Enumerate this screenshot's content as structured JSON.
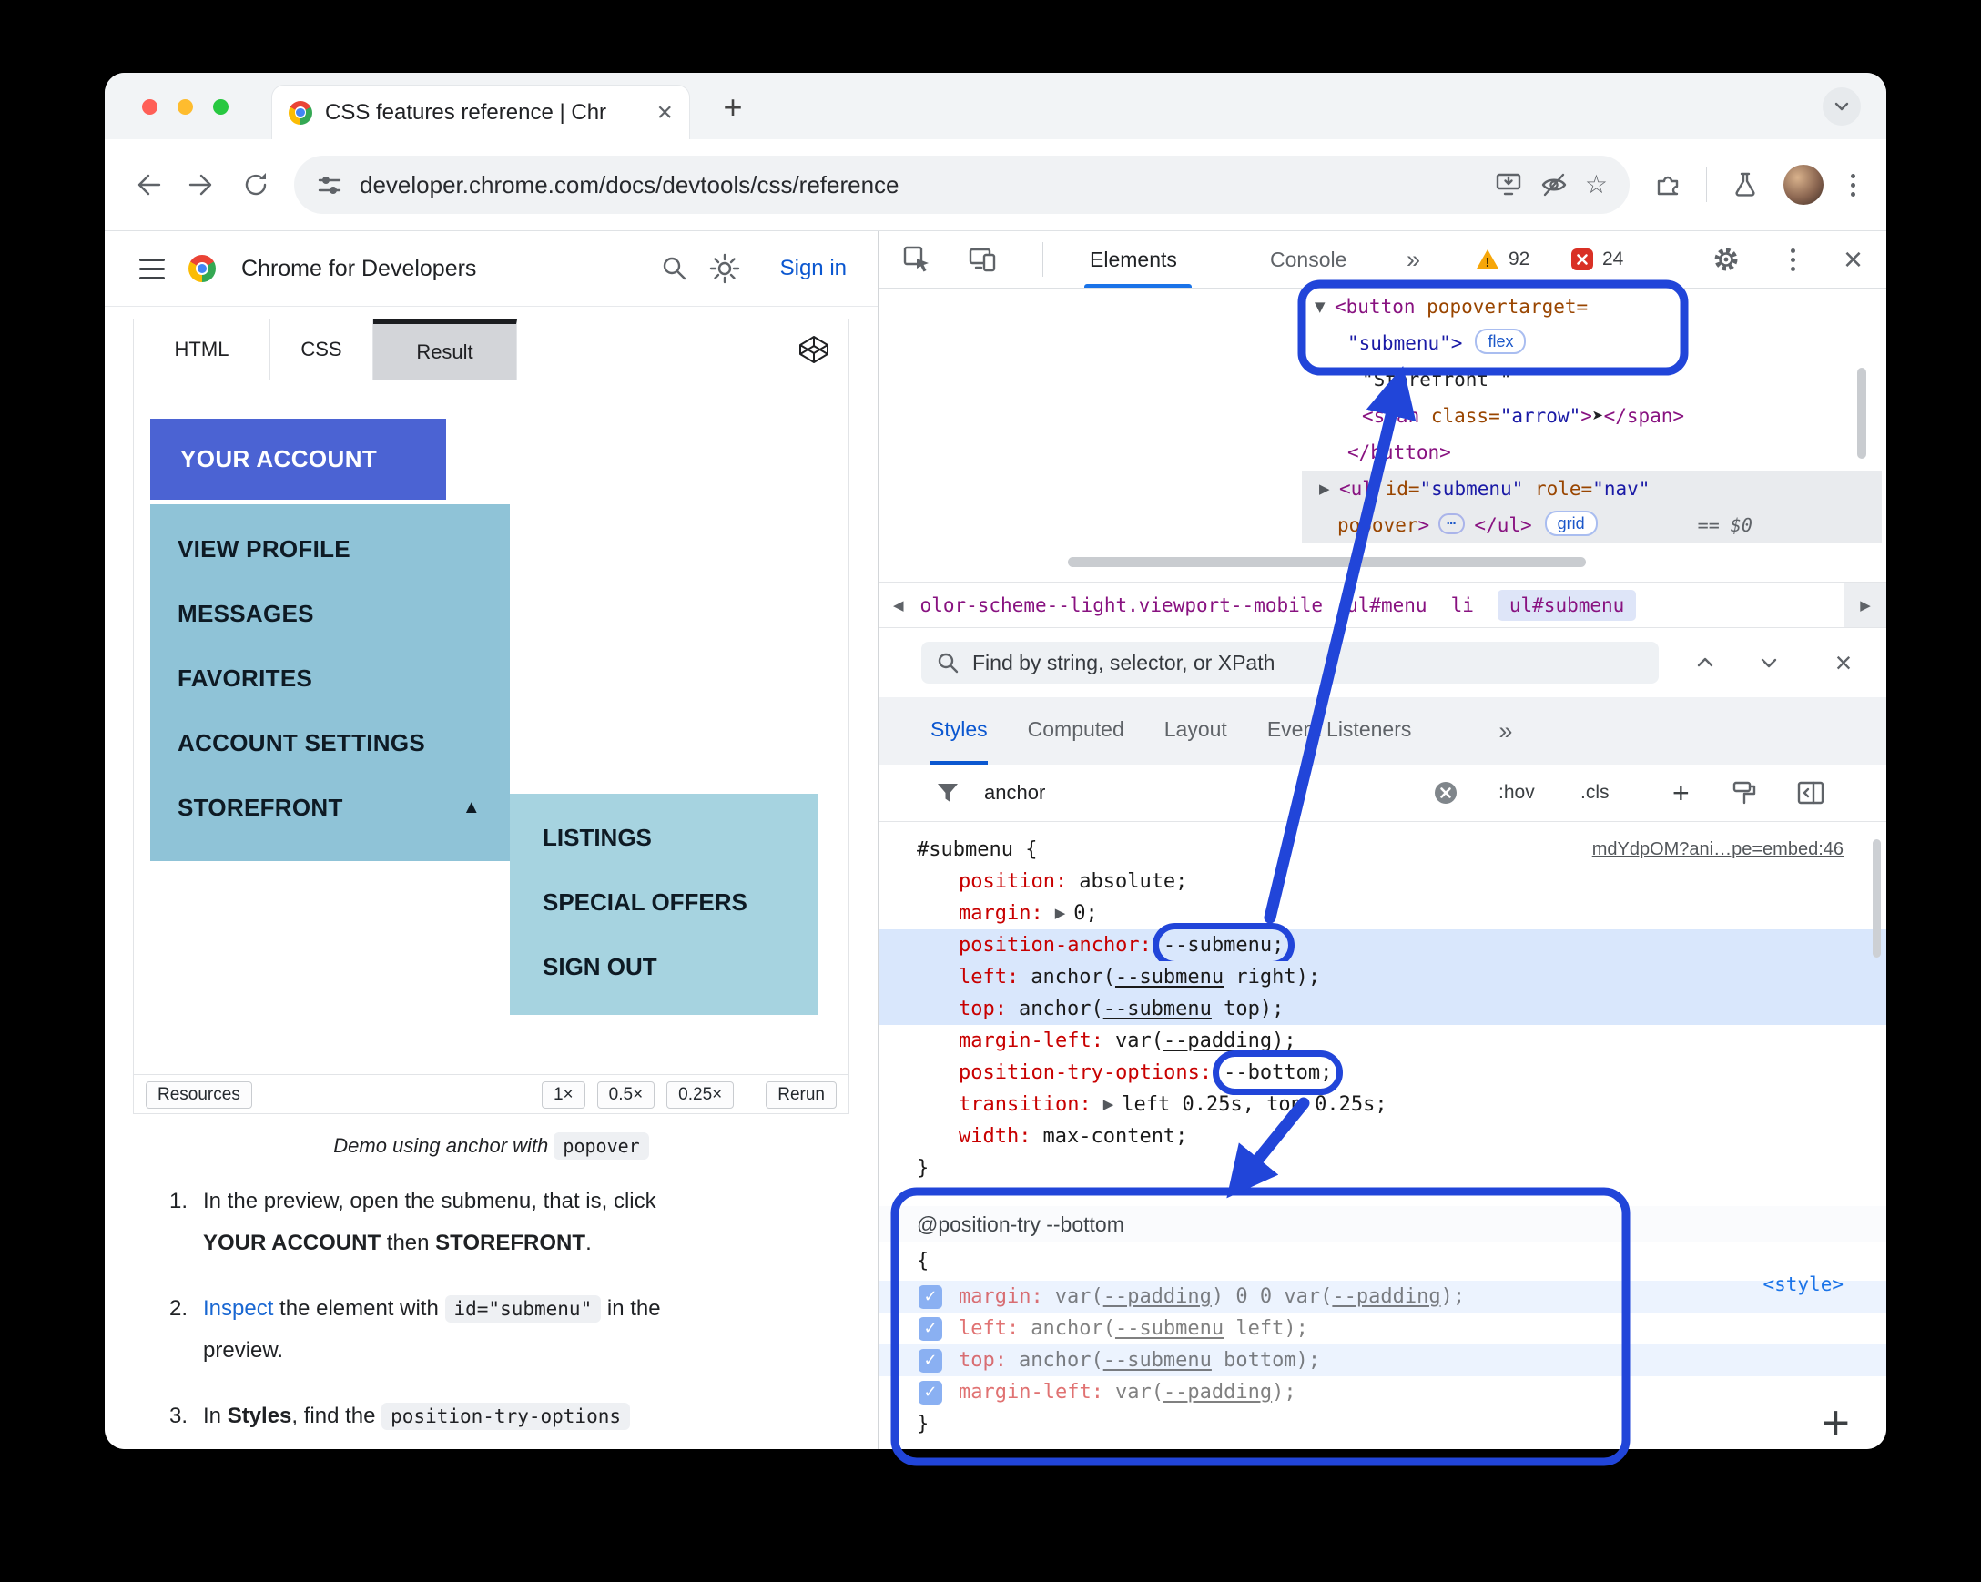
{
  "colors": {
    "annotation": "#2145d9",
    "accent_blue": "#1a73e8",
    "demo_button": "#4b63d3",
    "demo_menu": "#8fc3d7",
    "demo_submenu": "#a6d3e0",
    "warning": "#f6a609",
    "error": "#d93025"
  },
  "icons": {
    "close": "×",
    "plus": "+",
    "more": "»",
    "star": "☆",
    "tree_open": "▼",
    "tree_closed": "▶",
    "crumb_left": "◀",
    "crumb_right": "▶",
    "dots": "⋯",
    "check": "✓",
    "arrow_up": "▲"
  },
  "browser": {
    "tab_title": "CSS features reference  |  Chr",
    "url": "developer.chrome.com/docs/devtools/css/reference"
  },
  "docs": {
    "brand": "Chrome for Developers",
    "sign_in": "Sign in",
    "tabs": {
      "html": "HTML",
      "css": "CSS",
      "result": "Result"
    },
    "demo": {
      "account": "YOUR ACCOUNT",
      "items": [
        "VIEW PROFILE",
        "MESSAGES",
        "FAVORITES",
        "ACCOUNT SETTINGS"
      ],
      "storefront": "STOREFRONT",
      "sub_items": [
        "LISTINGS",
        "SPECIAL OFFERS",
        "SIGN OUT"
      ]
    },
    "footer": {
      "resources": "Resources",
      "s1": "1×",
      "s2": "0.5×",
      "s3": "0.25×",
      "rerun": "Rerun"
    },
    "caption": {
      "text": "Demo using anchor with ",
      "code": "popover"
    },
    "steps": {
      "n1": "1.",
      "s1a": "In the preview, open the submenu, that is, click",
      "s1b": "YOUR ACCOUNT",
      "s1c": " then ",
      "s1d": "STOREFRONT",
      "s1e": ".",
      "n2": "2.",
      "s2a": "Inspect",
      "s2b": " the element with ",
      "s2c": "id=\"submenu\"",
      "s2d": " in the",
      "s2e": "preview.",
      "n3": "3.",
      "s3a": "In ",
      "s3b": "Styles",
      "s3c": ", find the ",
      "s3d": "position-try-options"
    }
  },
  "devtools": {
    "tabs": {
      "elements": "Elements",
      "console": "Console"
    },
    "issues": {
      "warnings": "92",
      "errors": "24"
    },
    "tree": {
      "l1_tag": "<button",
      "l1_attr": " popovertarget=",
      "l2_val": "\"submenu\">",
      "l2_badge": "flex",
      "l3_text": "\"Storefront \"",
      "l4_o": "<span",
      "l4_attr": " class=",
      "l4_val": "\"arrow\"",
      "l4_b": ">",
      "l4_text": "➤",
      "l4_c": "</span>",
      "l5": "</button>",
      "l6_o": "<ul",
      "l6_a1": " id=",
      "l6_v1": "\"submenu\"",
      "l6_a2": " role=",
      "l6_v2": "\"nav\"",
      "l7_a": "popover",
      "l7_b": ">",
      "l7_c": "</ul>",
      "l7_badge": "grid",
      "l7_eq": "== $0"
    },
    "crumbs": {
      "c1": "olor-scheme--light.viewport--mobile",
      "c2": "ul#menu",
      "c3": "li",
      "c4": "ul#submenu"
    },
    "find": "Find by string, selector, or XPath",
    "panel_tabs": {
      "styles": "Styles",
      "computed": "Computed",
      "layout": "Layout",
      "events": "Event Listeners"
    },
    "filter": {
      "query": "anchor",
      "hov": ":hov",
      "cls": ".cls",
      "plus": "+"
    },
    "rule": {
      "selector": "#submenu {",
      "link": "mdYdpOM?ani…pe=embed:46",
      "p1n": "position:",
      "p1v": "absolute;",
      "p2n": "margin:",
      "p2v": "0;",
      "p3n": "position-anchor:",
      "p3v": "--submenu;",
      "p4n": "left:",
      "p4a": "anchor(",
      "p4b": "--submenu",
      "p4c": " right);",
      "p5n": "top:",
      "p5a": "anchor(",
      "p5b": "--submenu",
      "p5c": " top);",
      "p6n": "margin-left:",
      "p6a": "var(",
      "p6b": "--padding",
      "p6c": ");",
      "p7n": "position-try-options:",
      "p7v": "--bottom;",
      "p8n": "transition:",
      "p8v": "left 0.25s, top 0.25s;",
      "p9n": "width:",
      "p9v": "max-content;",
      "close": "}"
    },
    "attry": {
      "header": "@position-try --bottom",
      "open": "{",
      "r1n": "margin:",
      "r1a": "var(",
      "r1b": "--padding",
      "r1c": ") 0 0 var(",
      "r1d": "--padding",
      "r1e": ");",
      "r2n": "left:",
      "r2a": "anchor(",
      "r2b": "--submenu",
      "r2c": " left);",
      "r3n": "top:",
      "r3a": "anchor(",
      "r3b": "--submenu",
      "r3c": " bottom);",
      "r4n": "margin-left:",
      "r4a": "var(",
      "r4b": "--padding",
      "r4c": ");",
      "close": "}",
      "style_link": "<style>"
    }
  }
}
